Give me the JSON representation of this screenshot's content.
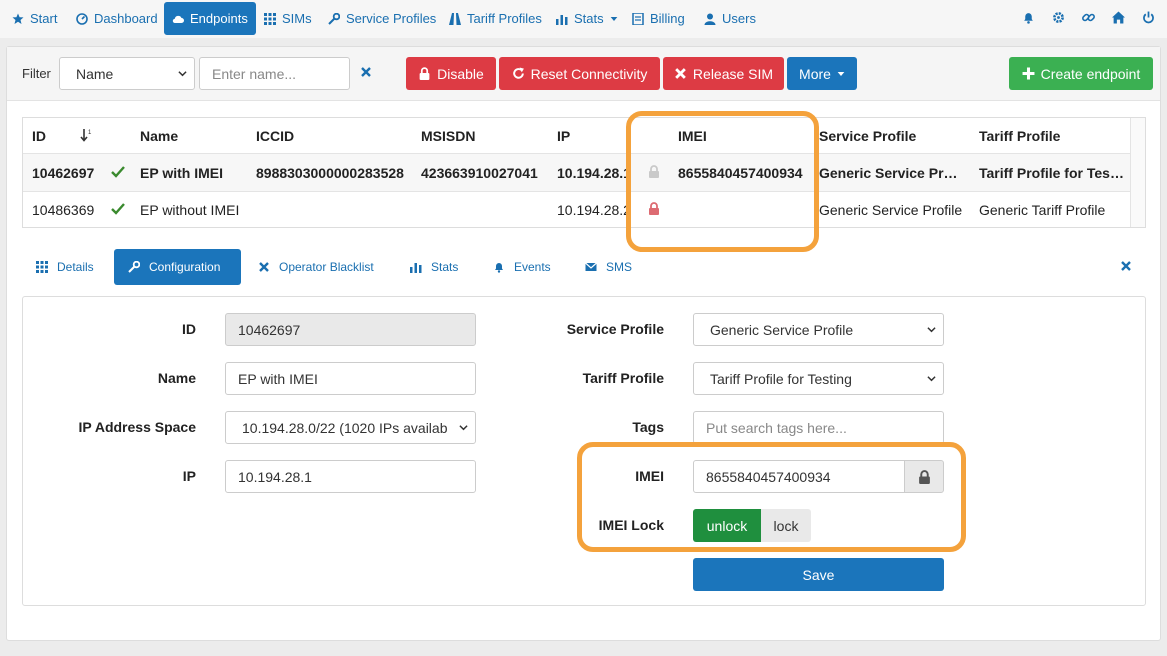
{
  "nav": {
    "start": "Start",
    "dashboard": "Dashboard",
    "endpoints": "Endpoints",
    "sims": "SIMs",
    "service_profiles": "Service Profiles",
    "tariff_profiles": "Tariff Profiles",
    "stats": "Stats",
    "billing": "Billing",
    "users": "Users",
    "right_icons": [
      "bell-icon",
      "gear-icon",
      "link-icon",
      "home-icon",
      "power-icon"
    ]
  },
  "filter": {
    "label": "Filter",
    "field_selected": "Name",
    "search_placeholder": "Enter name...",
    "disable_label": "Disable",
    "reset_label": "Reset Connectivity",
    "release_label": "Release SIM",
    "more_label": "More",
    "create_label": "Create endpoint"
  },
  "table": {
    "headers": [
      "ID",
      "Name",
      "ICCID",
      "MSISDN",
      "IP",
      "IMEI",
      "Service Profile",
      "Tariff Profile"
    ],
    "rows": [
      {
        "id": "10462697",
        "name": "EP with IMEI",
        "iccid": "8988303000000283528",
        "msisdn": "423663910027041",
        "ip": "10.194.28.1",
        "imei": "8655840457400934",
        "service_profile": "Generic Service Pr…",
        "tariff_profile": "Tariff Profile for Tes…",
        "status_icon": "check-icon",
        "lock_icon": "lock-icon-gray"
      },
      {
        "id": "10486369",
        "name": "EP without IMEI",
        "iccid": "",
        "msisdn": "",
        "ip": "10.194.28.2",
        "imei": "",
        "service_profile": "Generic Service Profile",
        "tariff_profile": "Generic Tariff Profile",
        "status_icon": "check-icon",
        "lock_icon": "lock-icon-red"
      }
    ]
  },
  "tabs": {
    "details": "Details",
    "configuration": "Configuration",
    "operator_blacklist": "Operator Blacklist",
    "stats": "Stats",
    "events": "Events",
    "sms": "SMS"
  },
  "form": {
    "id_label": "ID",
    "id_value": "10462697",
    "name_label": "Name",
    "name_value": "EP with IMEI",
    "ip_space_label": "IP Address Space",
    "ip_space_value": "10.194.28.0/22 (1020 IPs availab",
    "ip_label": "IP",
    "ip_value": "10.194.28.1",
    "service_profile_label": "Service Profile",
    "service_profile_value": "Generic Service Profile",
    "tariff_profile_label": "Tariff Profile",
    "tariff_profile_value": "Tariff Profile for Testing",
    "tags_label": "Tags",
    "tags_placeholder": "Put search tags here...",
    "imei_label": "IMEI",
    "imei_value": "8655840457400934",
    "imei_lock_label": "IMEI Lock",
    "unlock_label": "unlock",
    "lock_label": "lock",
    "save_label": "Save"
  },
  "colors": {
    "primary": "#1b75bb",
    "danger": "#dd3b44",
    "success": "#3bb052",
    "toggle_active": "#1f8f3e",
    "highlight": "#f4a23c"
  }
}
